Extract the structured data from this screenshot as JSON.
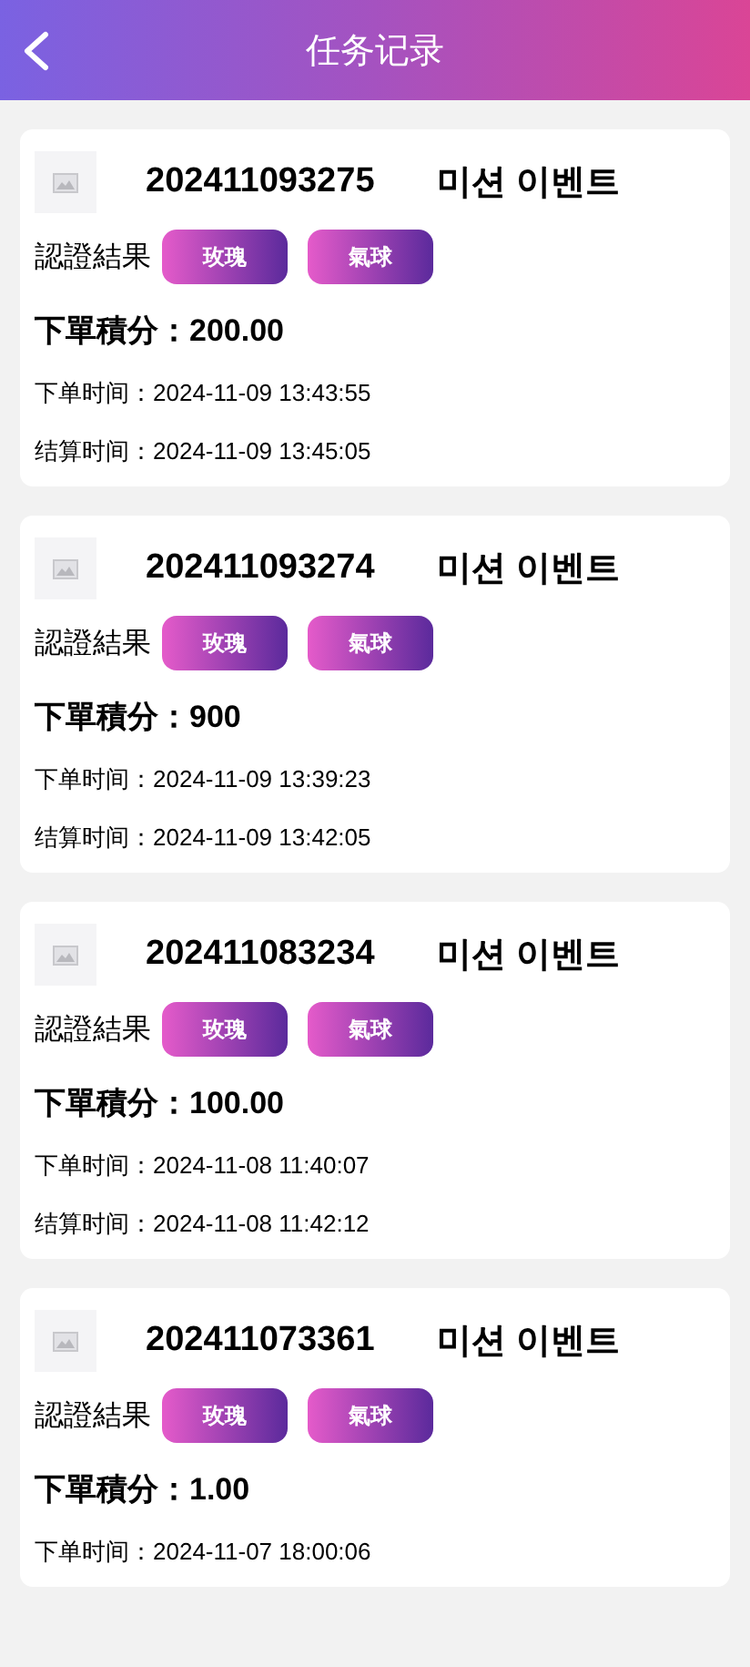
{
  "header": {
    "title": "任务记录"
  },
  "records": [
    {
      "order_no": "202411093275",
      "title": "미션 이벤트",
      "result_label": "認證結果",
      "tags": [
        "玫瑰",
        "氣球"
      ],
      "score": "下單積分：200.00",
      "order_time": "下单时间：2024-11-09 13:43:55",
      "settle_time": "结算时间：2024-11-09 13:45:05"
    },
    {
      "order_no": "202411093274",
      "title": "미션 이벤트",
      "result_label": "認證結果",
      "tags": [
        "玫瑰",
        "氣球"
      ],
      "score": "下單積分：900",
      "order_time": "下单时间：2024-11-09 13:39:23",
      "settle_time": "结算时间：2024-11-09 13:42:05"
    },
    {
      "order_no": "202411083234",
      "title": "미션 이벤트",
      "result_label": "認證結果",
      "tags": [
        "玫瑰",
        "氣球"
      ],
      "score": "下單積分：100.00",
      "order_time": "下单时间：2024-11-08 11:40:07",
      "settle_time": "结算时间：2024-11-08 11:42:12"
    },
    {
      "order_no": "202411073361",
      "title": "미션 이벤트",
      "result_label": "認證結果",
      "tags": [
        "玫瑰",
        "氣球"
      ],
      "score": "下單積分：1.00",
      "order_time": "下单时间：2024-11-07 18:00:06"
    }
  ]
}
